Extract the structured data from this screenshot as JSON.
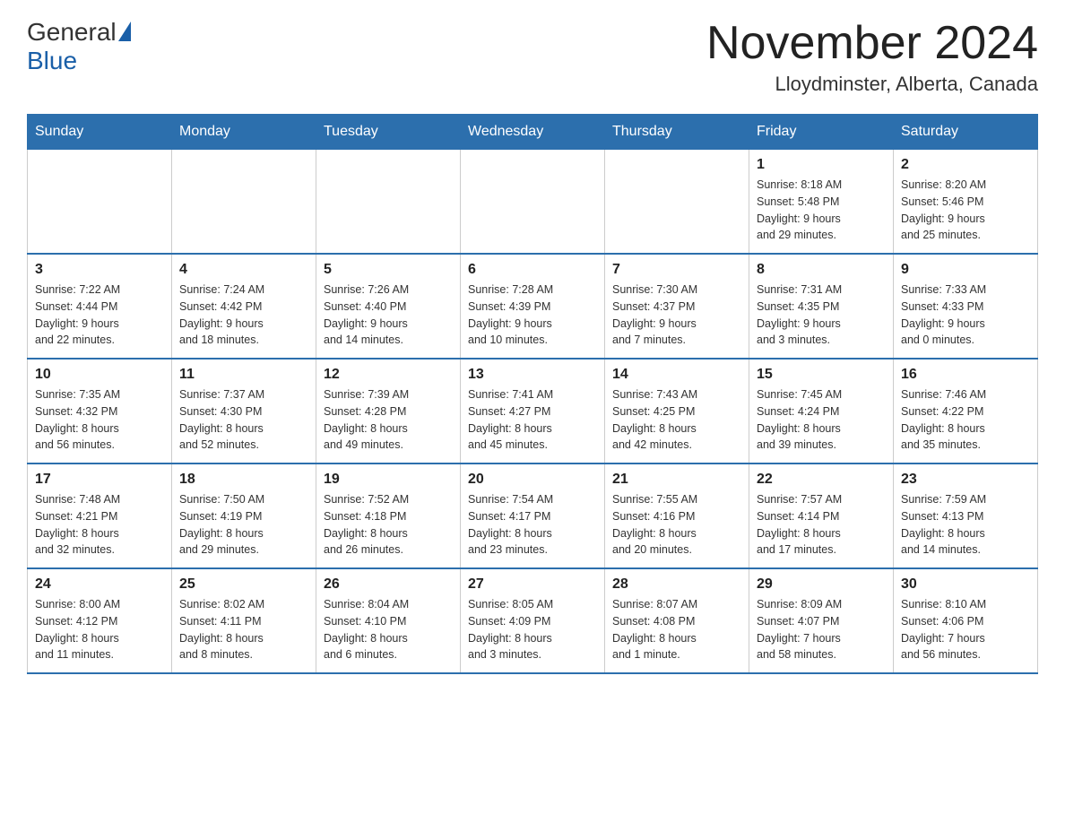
{
  "header": {
    "logo_general": "General",
    "logo_blue": "Blue",
    "title": "November 2024",
    "subtitle": "Lloydminster, Alberta, Canada"
  },
  "weekdays": [
    "Sunday",
    "Monday",
    "Tuesday",
    "Wednesday",
    "Thursday",
    "Friday",
    "Saturday"
  ],
  "weeks": [
    [
      {
        "day": "",
        "info": ""
      },
      {
        "day": "",
        "info": ""
      },
      {
        "day": "",
        "info": ""
      },
      {
        "day": "",
        "info": ""
      },
      {
        "day": "",
        "info": ""
      },
      {
        "day": "1",
        "info": "Sunrise: 8:18 AM\nSunset: 5:48 PM\nDaylight: 9 hours\nand 29 minutes."
      },
      {
        "day": "2",
        "info": "Sunrise: 8:20 AM\nSunset: 5:46 PM\nDaylight: 9 hours\nand 25 minutes."
      }
    ],
    [
      {
        "day": "3",
        "info": "Sunrise: 7:22 AM\nSunset: 4:44 PM\nDaylight: 9 hours\nand 22 minutes."
      },
      {
        "day": "4",
        "info": "Sunrise: 7:24 AM\nSunset: 4:42 PM\nDaylight: 9 hours\nand 18 minutes."
      },
      {
        "day": "5",
        "info": "Sunrise: 7:26 AM\nSunset: 4:40 PM\nDaylight: 9 hours\nand 14 minutes."
      },
      {
        "day": "6",
        "info": "Sunrise: 7:28 AM\nSunset: 4:39 PM\nDaylight: 9 hours\nand 10 minutes."
      },
      {
        "day": "7",
        "info": "Sunrise: 7:30 AM\nSunset: 4:37 PM\nDaylight: 9 hours\nand 7 minutes."
      },
      {
        "day": "8",
        "info": "Sunrise: 7:31 AM\nSunset: 4:35 PM\nDaylight: 9 hours\nand 3 minutes."
      },
      {
        "day": "9",
        "info": "Sunrise: 7:33 AM\nSunset: 4:33 PM\nDaylight: 9 hours\nand 0 minutes."
      }
    ],
    [
      {
        "day": "10",
        "info": "Sunrise: 7:35 AM\nSunset: 4:32 PM\nDaylight: 8 hours\nand 56 minutes."
      },
      {
        "day": "11",
        "info": "Sunrise: 7:37 AM\nSunset: 4:30 PM\nDaylight: 8 hours\nand 52 minutes."
      },
      {
        "day": "12",
        "info": "Sunrise: 7:39 AM\nSunset: 4:28 PM\nDaylight: 8 hours\nand 49 minutes."
      },
      {
        "day": "13",
        "info": "Sunrise: 7:41 AM\nSunset: 4:27 PM\nDaylight: 8 hours\nand 45 minutes."
      },
      {
        "day": "14",
        "info": "Sunrise: 7:43 AM\nSunset: 4:25 PM\nDaylight: 8 hours\nand 42 minutes."
      },
      {
        "day": "15",
        "info": "Sunrise: 7:45 AM\nSunset: 4:24 PM\nDaylight: 8 hours\nand 39 minutes."
      },
      {
        "day": "16",
        "info": "Sunrise: 7:46 AM\nSunset: 4:22 PM\nDaylight: 8 hours\nand 35 minutes."
      }
    ],
    [
      {
        "day": "17",
        "info": "Sunrise: 7:48 AM\nSunset: 4:21 PM\nDaylight: 8 hours\nand 32 minutes."
      },
      {
        "day": "18",
        "info": "Sunrise: 7:50 AM\nSunset: 4:19 PM\nDaylight: 8 hours\nand 29 minutes."
      },
      {
        "day": "19",
        "info": "Sunrise: 7:52 AM\nSunset: 4:18 PM\nDaylight: 8 hours\nand 26 minutes."
      },
      {
        "day": "20",
        "info": "Sunrise: 7:54 AM\nSunset: 4:17 PM\nDaylight: 8 hours\nand 23 minutes."
      },
      {
        "day": "21",
        "info": "Sunrise: 7:55 AM\nSunset: 4:16 PM\nDaylight: 8 hours\nand 20 minutes."
      },
      {
        "day": "22",
        "info": "Sunrise: 7:57 AM\nSunset: 4:14 PM\nDaylight: 8 hours\nand 17 minutes."
      },
      {
        "day": "23",
        "info": "Sunrise: 7:59 AM\nSunset: 4:13 PM\nDaylight: 8 hours\nand 14 minutes."
      }
    ],
    [
      {
        "day": "24",
        "info": "Sunrise: 8:00 AM\nSunset: 4:12 PM\nDaylight: 8 hours\nand 11 minutes."
      },
      {
        "day": "25",
        "info": "Sunrise: 8:02 AM\nSunset: 4:11 PM\nDaylight: 8 hours\nand 8 minutes."
      },
      {
        "day": "26",
        "info": "Sunrise: 8:04 AM\nSunset: 4:10 PM\nDaylight: 8 hours\nand 6 minutes."
      },
      {
        "day": "27",
        "info": "Sunrise: 8:05 AM\nSunset: 4:09 PM\nDaylight: 8 hours\nand 3 minutes."
      },
      {
        "day": "28",
        "info": "Sunrise: 8:07 AM\nSunset: 4:08 PM\nDaylight: 8 hours\nand 1 minute."
      },
      {
        "day": "29",
        "info": "Sunrise: 8:09 AM\nSunset: 4:07 PM\nDaylight: 7 hours\nand 58 minutes."
      },
      {
        "day": "30",
        "info": "Sunrise: 8:10 AM\nSunset: 4:06 PM\nDaylight: 7 hours\nand 56 minutes."
      }
    ]
  ]
}
